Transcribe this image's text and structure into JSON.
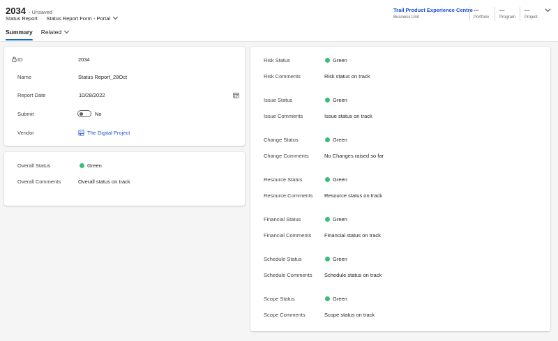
{
  "header": {
    "record_id": "2034",
    "unsaved": "- Unsaved",
    "entity": "Status Report",
    "separator": "·",
    "form": "Status Report Form - Portal",
    "business_unit": {
      "value": "Trail Product Experience Centre",
      "label": "Business Unit"
    },
    "portfolio": {
      "value": "---",
      "label": "Portfolio"
    },
    "program": {
      "value": "---",
      "label": "Program"
    },
    "project": {
      "value": "---",
      "label": "Project"
    }
  },
  "tabs": [
    {
      "label": "Summary",
      "active": true
    },
    {
      "label": "Related",
      "active": false
    }
  ],
  "general": {
    "id_label": "ID",
    "id_value": "2034",
    "name_label": "Name",
    "name_value": "Status Report_28Oct",
    "date_label": "Report Date",
    "date_value": "10/28/2022",
    "submit_label": "Submit",
    "submit_value": "No",
    "vendor_label": "Vendor",
    "vendor_value": "The Digital Project"
  },
  "overall": {
    "status_label": "Overall Status",
    "status_value": "Green",
    "comments_label": "Overall Comments",
    "comments_value": "Overall status on track"
  },
  "statuses": [
    {
      "status_label": "Risk Status",
      "status_value": "Green",
      "comments_label": "Risk Comments",
      "comments_value": "Risk status on track"
    },
    {
      "status_label": "Issue Status",
      "status_value": "Green",
      "comments_label": "Issue Comments",
      "comments_value": "Issue status on track"
    },
    {
      "status_label": "Change Status",
      "status_value": "Green",
      "comments_label": "Change Comments",
      "comments_value": "No Changes raised so far"
    },
    {
      "status_label": "Resource Status",
      "status_value": "Green",
      "comments_label": "Resource Comments",
      "comments_value": "Resource status on track"
    },
    {
      "status_label": "Financial Status",
      "status_value": "Green",
      "comments_label": "Financial Comments",
      "comments_value": "Financial status on track"
    },
    {
      "status_label": "Schedule Status",
      "status_value": "Green",
      "comments_label": "Schedule Comments",
      "comments_value": "Schedule status on track"
    },
    {
      "status_label": "Scope Status",
      "status_value": "Green",
      "comments_label": "Scope Comments",
      "comments_value": "Scope status on track"
    }
  ],
  "colors": {
    "status_green": "#3bbd73",
    "link": "#1a4fd6",
    "tab_accent": "#0f6cbd"
  }
}
